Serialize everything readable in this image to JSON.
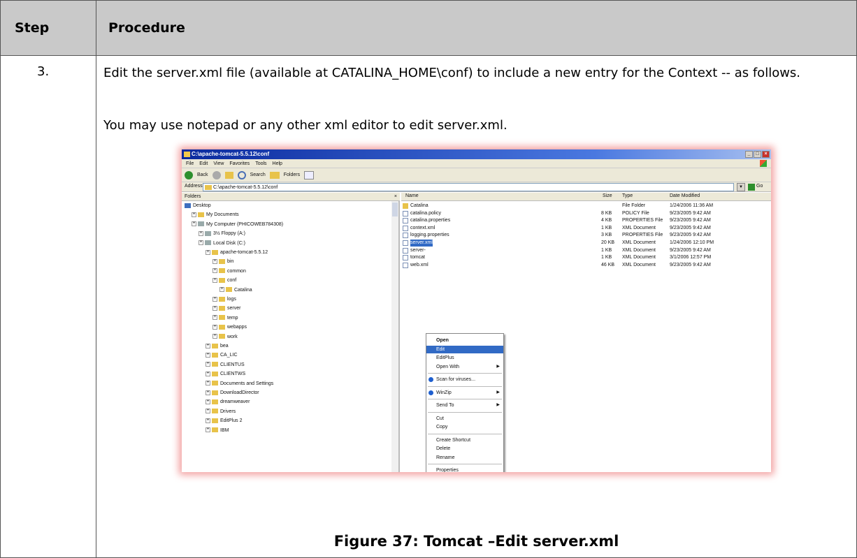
{
  "table": {
    "header_step": "Step",
    "header_procedure": "Procedure",
    "step_number": "3.",
    "paragraph1": "Edit the server.xml file (available at CATALINA_HOME\\conf) to include a new entry for the Context  -- as follows.",
    "paragraph2": "You may use notepad or any other xml editor to edit server.xml.",
    "caption": "Figure 37: Tomcat –Edit server.xml"
  },
  "screenshot": {
    "window_title": "C:\\apache-tomcat-5.5.12\\conf",
    "menu": [
      "File",
      "Edit",
      "View",
      "Favorites",
      "Tools",
      "Help"
    ],
    "toolbar": {
      "back": "Back",
      "search": "Search",
      "folders": "Folders"
    },
    "address_label": "Address",
    "address_value": "C:\\apache-tomcat-5.5.12\\conf",
    "go_label": "Go",
    "folders_pane_title": "Folders",
    "tree": [
      {
        "label": "Desktop",
        "level": 0,
        "icon": "blue"
      },
      {
        "label": "My Documents",
        "level": 1,
        "icon": "folder"
      },
      {
        "label": "My Computer (PHICOWEB784308)",
        "level": 1,
        "icon": "drive"
      },
      {
        "label": "3½ Floppy (A:)",
        "level": 2,
        "icon": "drive"
      },
      {
        "label": "Local Disk (C:)",
        "level": 2,
        "icon": "drive"
      },
      {
        "label": "apache-tomcat-5.5.12",
        "level": 3,
        "icon": "folder"
      },
      {
        "label": "bin",
        "level": 4,
        "icon": "folder"
      },
      {
        "label": "common",
        "level": 4,
        "icon": "folder"
      },
      {
        "label": "conf",
        "level": 4,
        "icon": "folder"
      },
      {
        "label": "Catalina",
        "level": 5,
        "icon": "folder"
      },
      {
        "label": "logs",
        "level": 4,
        "icon": "folder"
      },
      {
        "label": "server",
        "level": 4,
        "icon": "folder"
      },
      {
        "label": "temp",
        "level": 4,
        "icon": "folder"
      },
      {
        "label": "webapps",
        "level": 4,
        "icon": "folder"
      },
      {
        "label": "work",
        "level": 4,
        "icon": "folder"
      },
      {
        "label": "bea",
        "level": 3,
        "icon": "folder"
      },
      {
        "label": "CA_LIC",
        "level": 3,
        "icon": "folder"
      },
      {
        "label": "CLIENTUS",
        "level": 3,
        "icon": "folder"
      },
      {
        "label": "CLIENTWS",
        "level": 3,
        "icon": "folder"
      },
      {
        "label": "Documents and Settings",
        "level": 3,
        "icon": "folder"
      },
      {
        "label": "DownloadDirector",
        "level": 3,
        "icon": "folder"
      },
      {
        "label": "dreamweaver",
        "level": 3,
        "icon": "folder"
      },
      {
        "label": "Drivers",
        "level": 3,
        "icon": "folder"
      },
      {
        "label": "EditPlus 2",
        "level": 3,
        "icon": "folder"
      },
      {
        "label": "IBM",
        "level": 3,
        "icon": "folder"
      }
    ],
    "columns": [
      "Name",
      "Size",
      "Type",
      "Date Modified"
    ],
    "files": [
      {
        "name": "Catalina",
        "size": "",
        "type": "File Folder",
        "date": "1/24/2006 11:36 AM",
        "icon": "folder"
      },
      {
        "name": "catalina.policy",
        "size": "8 KB",
        "type": "POLICY File",
        "date": "9/23/2005 9:42 AM",
        "icon": "doc"
      },
      {
        "name": "catalina.properties",
        "size": "4 KB",
        "type": "PROPERTIES File",
        "date": "9/23/2005 9:42 AM",
        "icon": "doc"
      },
      {
        "name": "context.xml",
        "size": "1 KB",
        "type": "XML Document",
        "date": "9/23/2005 9:42 AM",
        "icon": "doc"
      },
      {
        "name": "logging.properties",
        "size": "3 KB",
        "type": "PROPERTIES File",
        "date": "9/23/2005 9:42 AM",
        "icon": "doc"
      },
      {
        "name": "server.xml",
        "size": "20 KB",
        "type": "XML Document",
        "date": "1/24/2006 12:10 PM",
        "icon": "doc"
      },
      {
        "name": "server-",
        "size": "1 KB",
        "type": "XML Document",
        "date": "9/23/2005 9:42 AM",
        "icon": "doc"
      },
      {
        "name": "tomcat",
        "size": "1 KB",
        "type": "XML Document",
        "date": "3/1/2006 12:57 PM",
        "icon": "doc"
      },
      {
        "name": "web.xml",
        "size": "46 KB",
        "type": "XML Document",
        "date": "9/23/2005 9:42 AM",
        "icon": "doc"
      }
    ],
    "context_menu": [
      {
        "label": "Open",
        "bold": true
      },
      {
        "label": "Edit",
        "highlight": true
      },
      {
        "label": "EditPlus"
      },
      {
        "label": "Open With",
        "submenu": true
      },
      {
        "separator": true
      },
      {
        "label": "Scan for viruses...",
        "icon": true
      },
      {
        "separator": true
      },
      {
        "label": "WinZip",
        "submenu": true,
        "icon": true
      },
      {
        "separator": true
      },
      {
        "label": "Send To",
        "submenu": true
      },
      {
        "separator": true
      },
      {
        "label": "Cut"
      },
      {
        "label": "Copy"
      },
      {
        "separator": true
      },
      {
        "label": "Create Shortcut"
      },
      {
        "label": "Delete"
      },
      {
        "label": "Rename"
      },
      {
        "separator": true
      },
      {
        "label": "Properties"
      }
    ]
  }
}
